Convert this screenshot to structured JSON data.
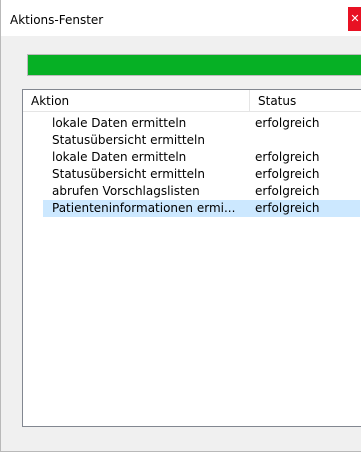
{
  "window": {
    "title": "Aktions-Fenster",
    "close_glyph": "✕"
  },
  "progress": {
    "value_percent": 100,
    "color": "#06b025"
  },
  "table": {
    "columns": [
      "Aktion",
      "Status"
    ],
    "rows": [
      {
        "aktion": "lokale Daten ermitteln",
        "status": "erfolgreich"
      },
      {
        "aktion": "Statusübersicht ermitteln",
        "status": ""
      },
      {
        "aktion": "lokale Daten ermitteln",
        "status": "erfolgreich"
      },
      {
        "aktion": "Statusübersicht ermitteln",
        "status": "erfolgreich"
      },
      {
        "aktion": "abrufen Vorschlagslisten",
        "status": "erfolgreich"
      },
      {
        "aktion": "Patienteninformationen ermi...",
        "status": "erfolgreich",
        "selected": true
      }
    ]
  }
}
